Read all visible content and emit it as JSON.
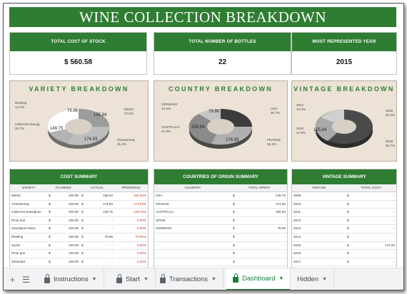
{
  "title": "WINE COLLECTION BREAKDOWN",
  "kpis": [
    {
      "label": "TOTAL COST OF STOCK",
      "value": "$ 560.58"
    },
    {
      "label": "TOTAL NUMBER OF BOTTLES",
      "value": "22"
    },
    {
      "label": "MOST REPRESENTED YEAR",
      "value": "2015"
    }
  ],
  "charts": {
    "variety": {
      "title": "VARIETY BREAKDOWN",
      "labels": [
        {
          "name": "Riesling",
          "pct": "14.3%"
        },
        {
          "name": "Cabernet Sauvig.",
          "pct": "26.7%"
        },
        {
          "name": "Merlot",
          "pct": "27.6%"
        },
        {
          "name": "Chardonnay",
          "pct": "31.2%"
        }
      ],
      "data_labels": [
        "79.96",
        "155.94",
        "149.75",
        "174.93"
      ]
    },
    "country": {
      "title": "COUNTRY BREAKDOWN",
      "labels": [
        {
          "name": "GERMANY",
          "pct": "14.3%"
        },
        {
          "name": "AUSTRALIA",
          "pct": "27.8%"
        },
        {
          "name": "USA",
          "pct": "26.7%"
        },
        {
          "name": "FRANCE",
          "pct": "31.2%"
        }
      ],
      "data_labels": [
        "79.96",
        "155.94",
        "174.93"
      ]
    },
    "vintage": {
      "title": "VINTAGE BREAKDOWN",
      "labels": [
        {
          "name": "2021",
          "pct": "14.3%"
        },
        {
          "name": "2020",
          "pct": "27.8%"
        },
        {
          "name": "2016",
          "pct": "31.2%"
        },
        {
          "name": "2015",
          "pct": "26.7%"
        }
      ],
      "data_labels": [
        "155.94"
      ]
    }
  },
  "cost_table": {
    "title": "COST SUMMARY",
    "columns": [
      "VARIETY",
      "PLANNED",
      "ACTUAL",
      "PROGRESS"
    ],
    "rows": [
      {
        "variety": "Merlot",
        "cur1": "$",
        "planned": "100.00",
        "cur2": "$",
        "actual": "155.94",
        "progress": "155.94%"
      },
      {
        "variety": "Chardonnay",
        "cur1": "$",
        "planned": "100.00",
        "cur2": "$",
        "actual": "174.93",
        "progress": "174.93%"
      },
      {
        "variety": "Cabernet Sauvignon",
        "cur1": "$",
        "planned": "100.00",
        "cur2": "$",
        "actual": "149.75",
        "progress": "149.75%"
      },
      {
        "variety": "Pinot noir",
        "cur1": "$",
        "planned": "100.00",
        "cur2": "$",
        "actual": "-",
        "progress": "0.00%"
      },
      {
        "variety": "Sauvignon blanc",
        "cur1": "$",
        "planned": "100.00",
        "cur2": "$",
        "actual": "-",
        "progress": "0.00%"
      },
      {
        "variety": "Riesling",
        "cur1": "$",
        "planned": "100.00",
        "cur2": "$",
        "actual": "79.96",
        "progress": "79.96%"
      },
      {
        "variety": "Syrah",
        "cur1": "$",
        "planned": "100.00",
        "cur2": "$",
        "actual": "-",
        "progress": "0.00%"
      },
      {
        "variety": "Pinot gris",
        "cur1": "$",
        "planned": "100.00",
        "cur2": "$",
        "actual": "-",
        "progress": "0.00%"
      },
      {
        "variety": "Zinfandel",
        "cur1": "$",
        "planned": "100.00",
        "cur2": "$",
        "actual": "-",
        "progress": "0.00%"
      }
    ]
  },
  "country_table": {
    "title": "COUNTRIES OF ORIGIN SUMMARY",
    "columns": [
      "COUNTRY",
      "TOTAL SPENT"
    ],
    "rows": [
      {
        "country": "USA",
        "cur": "$",
        "spent": "149.75"
      },
      {
        "country": "FRANCE",
        "cur": "$",
        "spent": "174.93"
      },
      {
        "country": "AUSTRALIA",
        "cur": "$",
        "spent": "155.94"
      },
      {
        "country": "SPAIN",
        "cur": "$",
        "spent": "-"
      },
      {
        "country": "GERMANY",
        "cur": "$",
        "spent": "79.96"
      },
      {
        "country": "",
        "cur": "$",
        "spent": "-"
      },
      {
        "country": "",
        "cur": "$",
        "spent": "-"
      },
      {
        "country": "",
        "cur": "$",
        "spent": "-"
      },
      {
        "country": "",
        "cur": "$",
        "spent": "-"
      }
    ]
  },
  "vintage_table": {
    "title": "VINTAGE SUMMARY",
    "columns": [
      "VINTAGE",
      "TOTAL COST"
    ],
    "rows": [
      {
        "year": "2009",
        "cur": "$",
        "cost": "-"
      },
      {
        "year": "2010",
        "cur": "$",
        "cost": "-"
      },
      {
        "year": "2011",
        "cur": "$",
        "cost": "-"
      },
      {
        "year": "2012",
        "cur": "$",
        "cost": "-"
      },
      {
        "year": "2013",
        "cur": "$",
        "cost": "-"
      },
      {
        "year": "2014",
        "cur": "$",
        "cost": "-"
      },
      {
        "year": "2015",
        "cur": "$",
        "cost": "174.93"
      },
      {
        "year": "2016",
        "cur": "$",
        "cost": "-"
      },
      {
        "year": "2017",
        "cur": "$",
        "cost": "-"
      }
    ]
  },
  "tabs": [
    {
      "label": "Instructions",
      "locked": true,
      "active": false
    },
    {
      "label": "Start",
      "locked": true,
      "active": false
    },
    {
      "label": "Transactions",
      "locked": true,
      "active": false
    },
    {
      "label": "Dashboard",
      "locked": true,
      "active": true
    },
    {
      "label": "Hidden",
      "locked": false,
      "active": false
    }
  ],
  "colors": {
    "accent": "#2e7d32",
    "panel_bg": "#ece2d6",
    "active_tab": "#188038",
    "progress_red": "#c0392b"
  }
}
